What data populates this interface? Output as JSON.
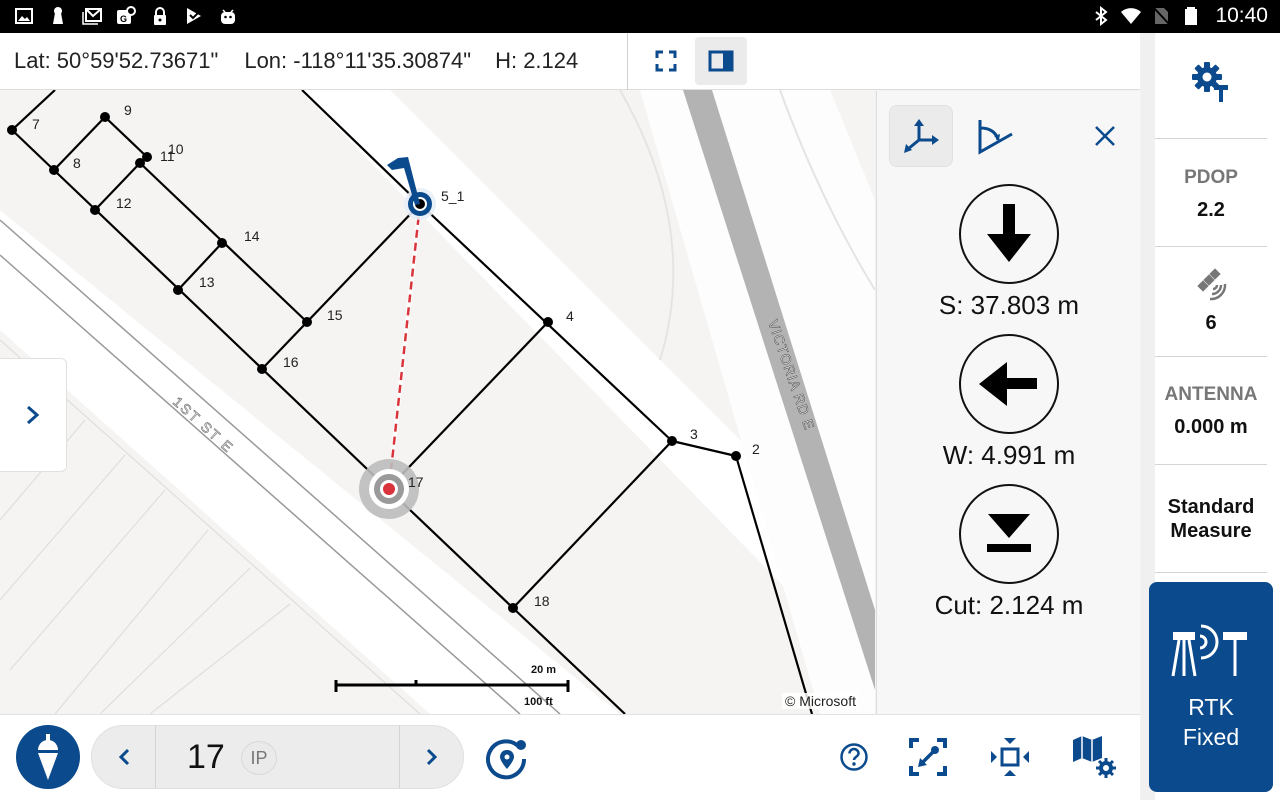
{
  "status_bar": {
    "left_icons": [
      "gallery-icon",
      "keyhole-icon",
      "gmail-icon",
      "google-maps-icon",
      "lock-icon",
      "checkmark-app-icon",
      "android-icon"
    ],
    "right_icons": [
      "bluetooth-icon",
      "wifi-icon",
      "no-sim-icon",
      "battery-icon"
    ],
    "time": "10:40"
  },
  "coord_bar": {
    "lat": "Lat: 50°59'52.73671\"",
    "lon": "Lon: -118°11'35.30874\"",
    "height": "H: 2.124",
    "view_buttons": [
      {
        "name": "fullscreen",
        "icon": "fullscreen-icon",
        "active": false
      },
      {
        "name": "split-view",
        "icon": "split-panel-icon",
        "active": true
      }
    ]
  },
  "map": {
    "points": [
      {
        "id": "2",
        "label": "2"
      },
      {
        "id": "3",
        "label": "3"
      },
      {
        "id": "4",
        "label": "4"
      },
      {
        "id": "5_1",
        "label": "5_1"
      },
      {
        "id": "7",
        "label": "7"
      },
      {
        "id": "8",
        "label": "8"
      },
      {
        "id": "9",
        "label": "9"
      },
      {
        "id": "10",
        "label": "10"
      },
      {
        "id": "11",
        "label": "11"
      },
      {
        "id": "12",
        "label": "12"
      },
      {
        "id": "13",
        "label": "13"
      },
      {
        "id": "14",
        "label": "14"
      },
      {
        "id": "15",
        "label": "15"
      },
      {
        "id": "16",
        "label": "16"
      },
      {
        "id": "17",
        "label": "17"
      },
      {
        "id": "18",
        "label": "18"
      }
    ],
    "streets": [
      "VICTORIA RD E",
      "1ST ST E"
    ],
    "current_position_point": "5_1",
    "target_point": "17",
    "scale_metric": "20 m",
    "scale_imperial": "100 ft",
    "copyright": "© Microsoft"
  },
  "nav_panel": {
    "tools": [
      {
        "name": "coordinate-axes",
        "icon": "axes-icon",
        "active": true
      },
      {
        "name": "angle",
        "icon": "angle-icon",
        "active": false
      }
    ],
    "close_icon": "close-icon",
    "directions": [
      {
        "icon": "arrow-down-icon",
        "text": "S: 37.803 m"
      },
      {
        "icon": "arrow-left-icon",
        "text": "W: 4.991 m"
      },
      {
        "icon": "cut-icon",
        "text": "Cut: 2.124 m"
      }
    ]
  },
  "bottom_bar": {
    "measure_icon": "plumb-bob-icon",
    "point_name": "17",
    "point_badge": "IP",
    "prev_icon": "chevron-left-icon",
    "next_icon": "chevron-right-icon",
    "locate_icon": "locate-point-icon",
    "tools": [
      {
        "name": "help",
        "icon": "help-icon"
      },
      {
        "name": "zoom-to-point",
        "icon": "zoom-to-point-icon"
      },
      {
        "name": "zoom-extents",
        "icon": "zoom-extents-icon"
      },
      {
        "name": "map-settings",
        "icon": "map-settings-icon"
      }
    ]
  },
  "right_rail": {
    "settings_icon": "gear-antenna-icon",
    "pdop_label": "PDOP",
    "pdop_value": "2.2",
    "satellite_icon": "satellite-icon",
    "satellite_count": "6",
    "antenna_label": "ANTENNA",
    "antenna_value": "0.000 m",
    "mode_label": "Standard Measure",
    "rtk_icon": "rtk-radio-icon",
    "rtk_status": "RTK Fixed"
  },
  "colors": {
    "brand_blue": "#0b4a8c",
    "stakeout_line": "#d9343b"
  }
}
